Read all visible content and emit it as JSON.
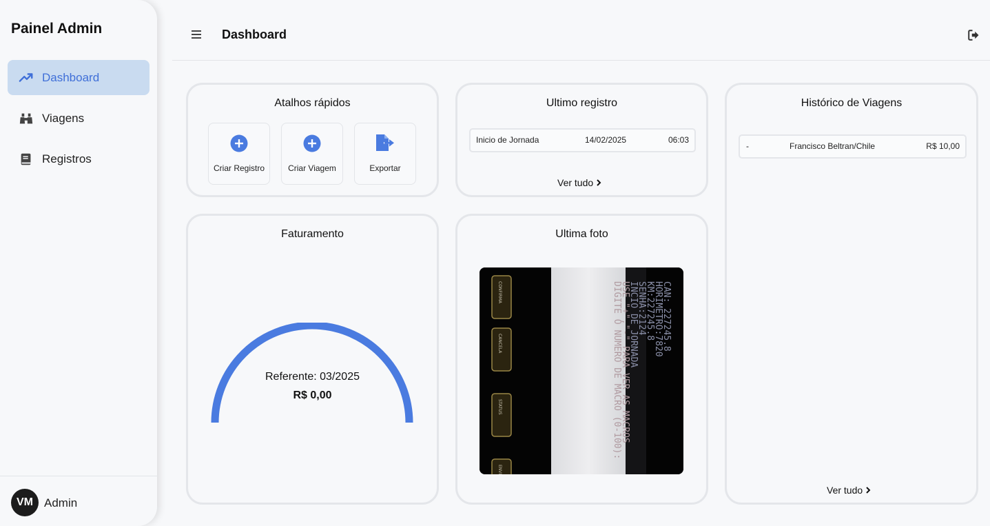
{
  "sidebar": {
    "brand": "Painel Admin",
    "items": [
      {
        "label": "Dashboard",
        "icon": "trending-up-icon",
        "active": true
      },
      {
        "label": "Viagens",
        "icon": "binoculars-icon",
        "active": false
      },
      {
        "label": "Registros",
        "icon": "book-icon",
        "active": false
      }
    ],
    "user": {
      "initials": "VM",
      "name": "Admin"
    }
  },
  "header": {
    "title": "Dashboard",
    "menu_icon": "hamburger-icon",
    "logout_icon": "logout-icon"
  },
  "quick_actions": {
    "title": "Atalhos rápidos",
    "items": [
      {
        "label": "Criar Registro",
        "icon": "plus-circle-icon"
      },
      {
        "label": "Criar Viagem",
        "icon": "plus-circle-icon"
      },
      {
        "label": "Exportar",
        "icon": "file-export-icon"
      }
    ]
  },
  "last_record": {
    "title": "Ultimo registro",
    "row": {
      "type": "Inicio de Jornada",
      "date": "14/02/2025",
      "time": "06:03"
    },
    "see_all": "Ver tudo"
  },
  "trip_history": {
    "title": "Histórico de Viagens",
    "rows": [
      {
        "col1": "-",
        "route": "Francisco Beltran/Chile",
        "amount": "R$ 10,00"
      }
    ],
    "see_all": "Ver tudo"
  },
  "billing": {
    "title": "Faturamento",
    "reference": "Referente: 03/2025",
    "amount": "R$ 0,00",
    "progress": 1.0,
    "accent": "#4a7be0"
  },
  "last_photo": {
    "title": "Ultima foto",
    "screen_lines": [
      "DIGITE O NUMERO DE MACRO (0-100):",
      "USE \"+\",\"-\" PARA VER AS MACROS",
      "INCIO DE JORNADA",
      "SENHA:2124",
      "KM:227245.8",
      "HORIMETRO:7820",
      "CAN: 227245.8"
    ],
    "key_labels": [
      "CONFIRMA",
      "CANCELA",
      "STATUS",
      "ENVIA"
    ]
  },
  "colors": {
    "accent": "#4a7be0",
    "active_bg": "#c9dbf0",
    "border": "#e4e6ea",
    "background": "#f7f8fa"
  }
}
